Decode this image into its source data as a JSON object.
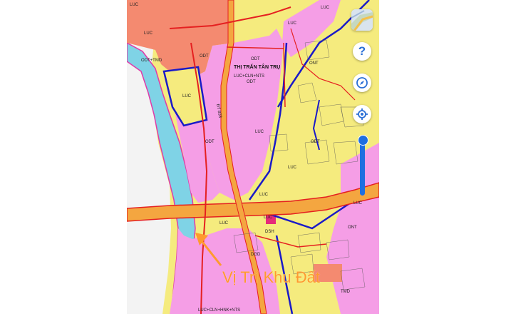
{
  "map": {
    "town_label": "THỊ TRẤN TÂN TRỤ",
    "zone_labels": {
      "odt": "ODT",
      "luc": "LUC",
      "onnt": "ONT",
      "dgd": "DGD",
      "dsh": "DSH",
      "tmd": "TMD",
      "nts": "NTS",
      "cln": "LUC+CLN+NTS",
      "mixed_odt": "LUC+CLN+NTS",
      "bottom_mixed": "LUC+CLN+HNK+NTS",
      "odt_mixed": "ODT+TMD"
    },
    "road_labels": {
      "dt833": "ĐT 833"
    },
    "colors": {
      "residential_pink": "#f59ee6",
      "residential_red": "#f48a70",
      "agriculture_yellow": "#f5eb7e",
      "water": "#7fd3e6",
      "road_orange": "#f4a640",
      "road_red": "#e52020",
      "boundary_blue": "#1a1ac8",
      "highlight_orange": "#ff9a2e"
    }
  },
  "controls": {
    "layers_icon": "map-layers-icon",
    "help_symbol": "?",
    "compass_icon": "compass-icon",
    "locate_icon": "crosshair-locate-icon",
    "zoom_level_fraction": 0.0
  },
  "annotation": {
    "land_label": "Vị Trí Khu Đất",
    "arrow_icon": "arrow-up-left-icon"
  }
}
